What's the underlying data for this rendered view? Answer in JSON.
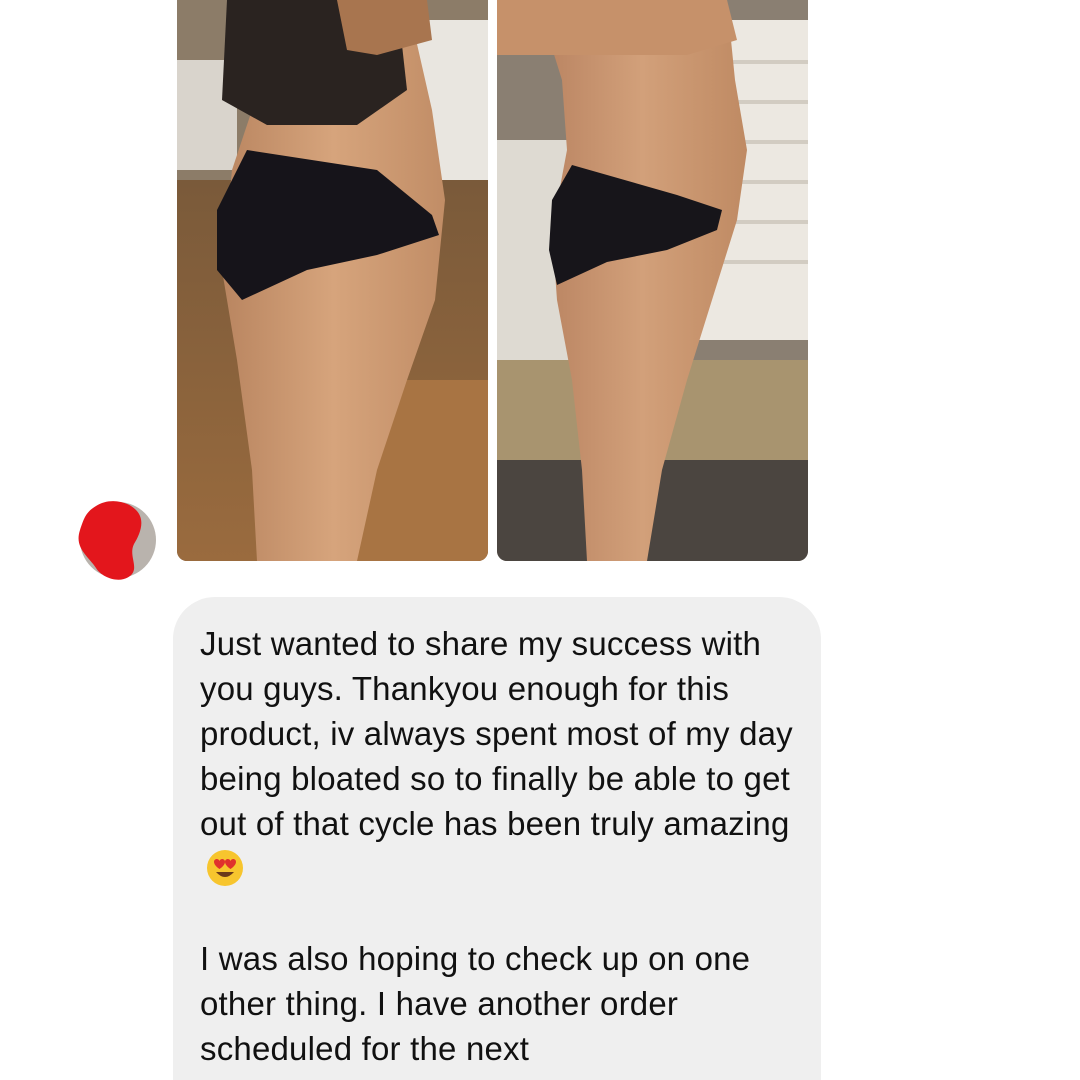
{
  "chat": {
    "sender_avatar": {
      "icon": "redacted-avatar-icon",
      "redaction_color": "#e3161c"
    },
    "attachments": [
      {
        "name": "before-photo",
        "icon": "photo-icon"
      },
      {
        "name": "after-photo",
        "icon": "photo-icon"
      }
    ],
    "message": {
      "paragraph_1": "Just wanted to share my success with you guys. Thankyou enough for this product, iv always spent most of my day being bloated so to finally be able to get out of that cycle has been truly amazing",
      "emoji": "heart-eyes-emoji",
      "paragraph_2": "I was also hoping to check up on one other thing. I have another order scheduled for the next"
    }
  },
  "colors": {
    "bubble_background": "#efefef",
    "text": "#111111",
    "redaction": "#e3161c"
  }
}
